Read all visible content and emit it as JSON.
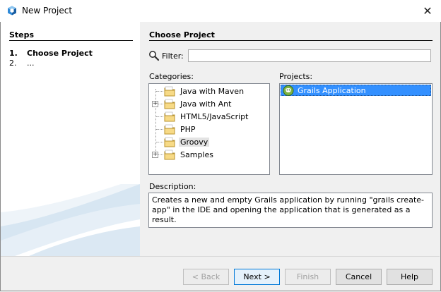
{
  "window": {
    "title": "New Project",
    "close_glyph": "✕"
  },
  "steps": {
    "title": "Steps",
    "items": [
      {
        "num": "1.",
        "label": "Choose Project"
      },
      {
        "num": "2.",
        "label": "..."
      }
    ]
  },
  "panel": {
    "title": "Choose Project",
    "filter_label": "Filter:",
    "filter_value": "",
    "categories_label": "Categories:",
    "projects_label": "Projects:",
    "categories": [
      {
        "label": "Java with Maven",
        "expandable": false
      },
      {
        "label": "Java with Ant",
        "expandable": true
      },
      {
        "label": "HTML5/JavaScript",
        "expandable": false
      },
      {
        "label": "PHP",
        "expandable": false
      },
      {
        "label": "Groovy",
        "expandable": false,
        "selected": true
      },
      {
        "label": "Samples",
        "expandable": true
      }
    ],
    "projects": [
      {
        "label": "Grails Application",
        "selected": true
      }
    ],
    "description_label": "Description:",
    "description": "Creates a new and empty Grails application by running \"grails create-app\" in the IDE and opening the application that is generated as a result."
  },
  "buttons": {
    "back": "< Back",
    "next": "Next >",
    "finish": "Finish",
    "cancel": "Cancel",
    "help": "Help"
  },
  "colors": {
    "selection": "#3390ff",
    "default_button_border": "#0078d7"
  }
}
